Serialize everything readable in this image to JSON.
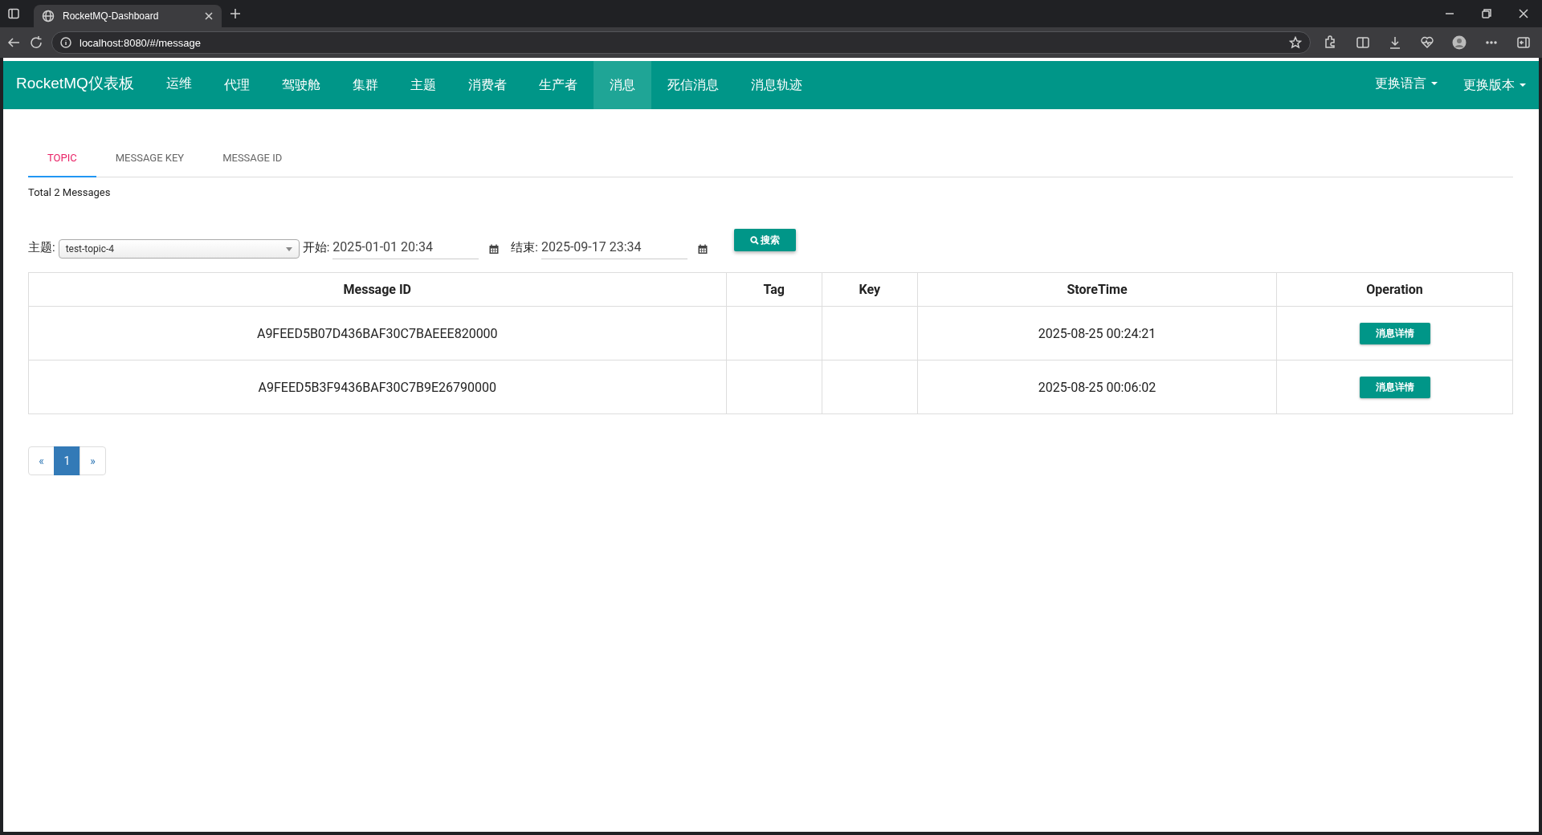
{
  "browser": {
    "tab_title": "RocketMQ-Dashboard",
    "url": "localhost:8080/#/message"
  },
  "navbar": {
    "brand": "RocketMQ仪表板",
    "items": [
      {
        "label": "运维",
        "selected": false
      },
      {
        "label": "代理",
        "selected": false
      },
      {
        "label": "驾驶舱",
        "selected": false
      },
      {
        "label": "集群",
        "selected": false
      },
      {
        "label": "主题",
        "selected": false
      },
      {
        "label": "消费者",
        "selected": false
      },
      {
        "label": "生产者",
        "selected": false
      },
      {
        "label": "消息",
        "selected": true
      },
      {
        "label": "死信消息",
        "selected": false
      },
      {
        "label": "消息轨迹",
        "selected": false
      }
    ],
    "menus": [
      "更换语言",
      "更换版本"
    ]
  },
  "tabs": [
    {
      "label": "TOPIC",
      "selected": true
    },
    {
      "label": "MESSAGE KEY",
      "selected": false
    },
    {
      "label": "MESSAGE ID",
      "selected": false
    }
  ],
  "total": "Total 2 Messages",
  "form": {
    "topic_label": "主题:",
    "topic_value": "test-topic-4",
    "start_label": "开始:",
    "start_value": "2025-01-01 20:34",
    "end_label": "结束:",
    "end_value": "2025-09-17 23:34",
    "search_button": "搜索"
  },
  "table": {
    "columns": [
      "Message ID",
      "Tag",
      "Key",
      "StoreTime",
      "Operation"
    ],
    "rows": [
      {
        "message_id": "A9FEED5B07D436BAF30C7BAEEE820000",
        "store_time": "2025-08-25 00:24:21",
        "action": "消息详情"
      },
      {
        "message_id": "A9FEED5B3F9436BAF30C7B9E26790000",
        "store_time": "2025-08-25 00:06:02",
        "action": "消息详情"
      }
    ]
  },
  "pagination": {
    "prev": "«",
    "pages": [
      {
        "label": "1",
        "selected": true
      }
    ],
    "next": "»"
  }
}
